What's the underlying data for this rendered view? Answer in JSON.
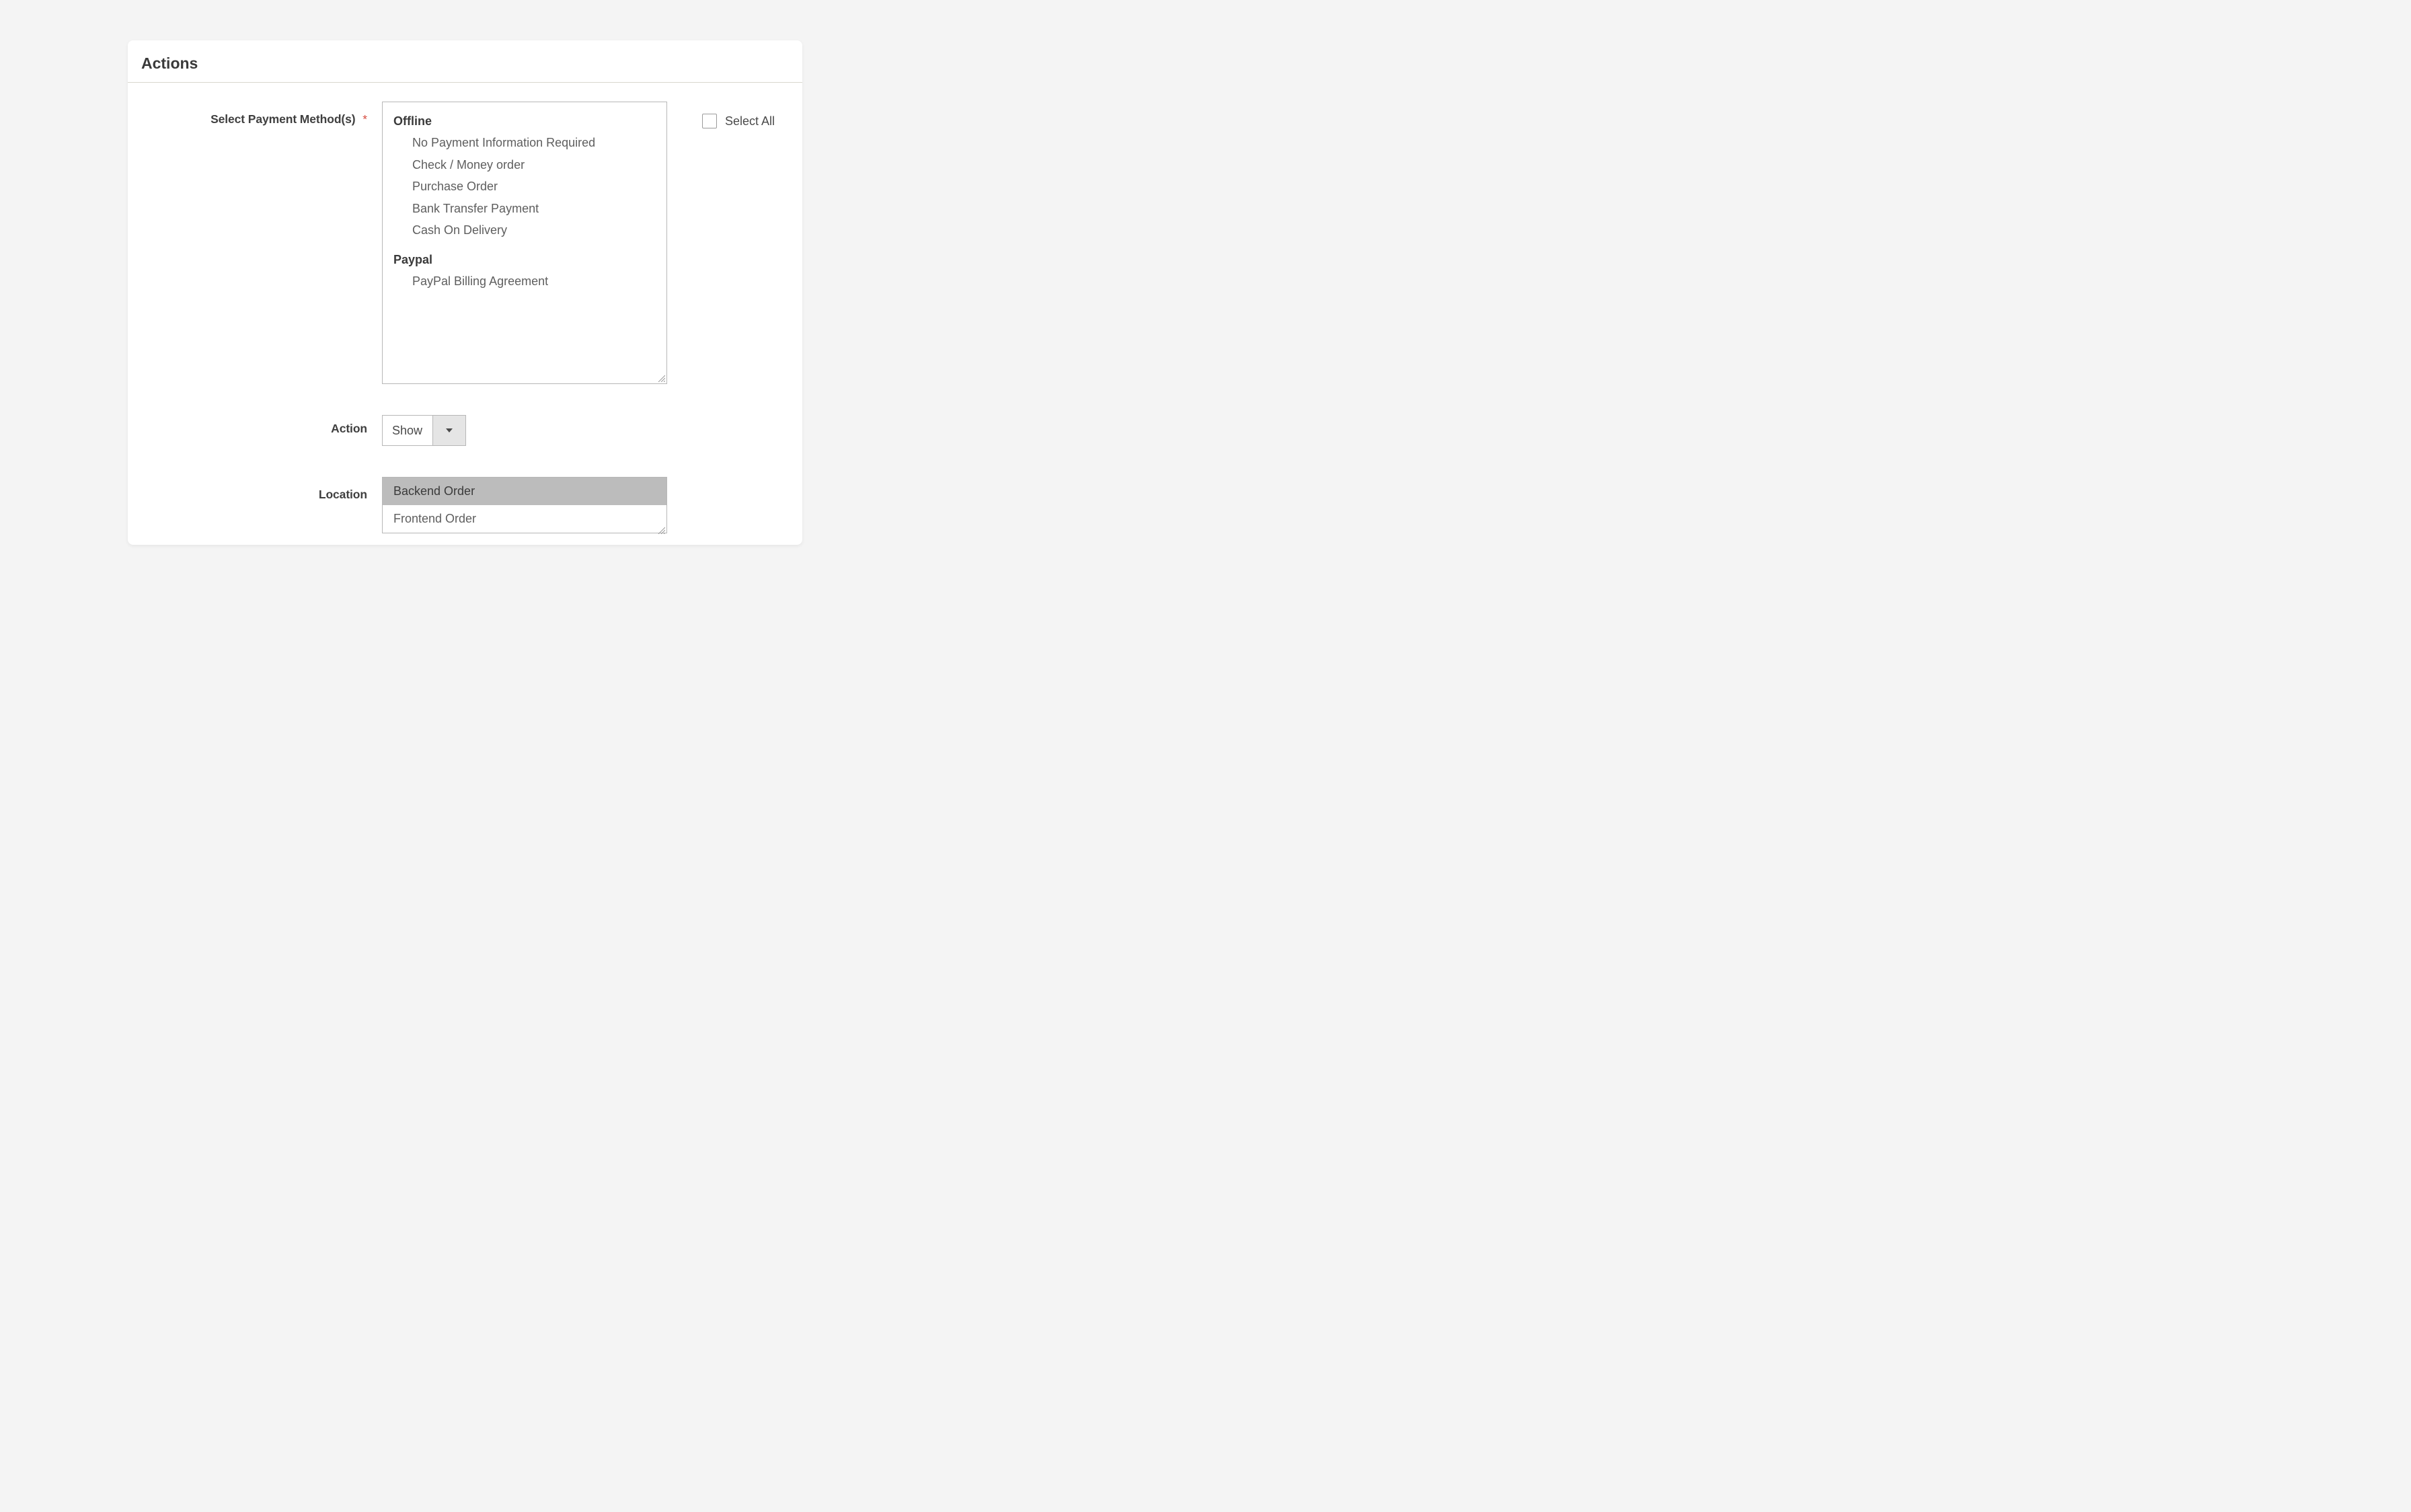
{
  "panel": {
    "title": "Actions"
  },
  "fields": {
    "payment_methods": {
      "label": "Select Payment Method(s)",
      "required_mark": "*",
      "groups": [
        {
          "title": "Offline",
          "items": [
            "No Payment Information Required",
            "Check / Money order",
            "Purchase Order",
            "Bank Transfer Payment",
            "Cash On Delivery"
          ]
        },
        {
          "title": "Paypal",
          "items": [
            "PayPal Billing Agreement"
          ]
        }
      ],
      "select_all_label": "Select All"
    },
    "action": {
      "label": "Action",
      "value": "Show"
    },
    "location": {
      "label": "Location",
      "options": [
        "Backend Order",
        "Frontend Order"
      ],
      "selected": "Backend Order"
    }
  }
}
